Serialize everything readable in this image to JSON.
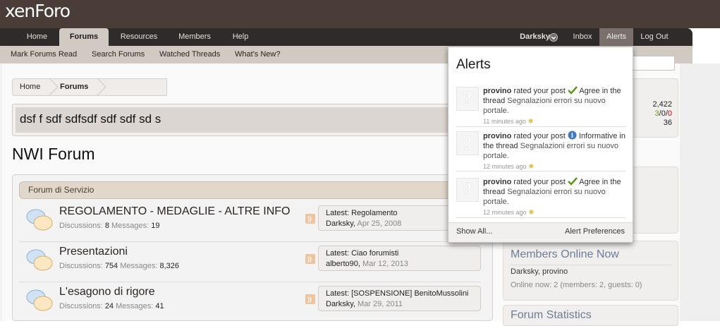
{
  "header": {
    "logo": "xenForo"
  },
  "nav": {
    "tabs": [
      "Home",
      "Forums",
      "Resources",
      "Members",
      "Help"
    ],
    "user": "Darksky",
    "right_links": [
      "Inbox",
      "Alerts",
      "Log Out"
    ]
  },
  "subnav": [
    "Mark Forums Read",
    "Search Forums",
    "Watched Threads",
    "What's New?"
  ],
  "breadcrumb": [
    "Home",
    "Forums"
  ],
  "notice": "dsf f sdf sdfsdf sdf sdf sd s",
  "page_title": "NWI Forum",
  "category": "Forum di Servizio",
  "forums": [
    {
      "title": "REGOLAMENTO - MEDAGLIE - ALTRE INFO",
      "disc_label": "Discussions:",
      "disc": "8",
      "msg_label": "Messages:",
      "msgs": "19",
      "latest_label": "Latest:",
      "latest_title": "Regolamento",
      "latest_user": "Darksky,",
      "latest_date": "Apr 25, 2008"
    },
    {
      "title": "Presentazioni",
      "disc_label": "Discussions:",
      "disc": "754",
      "msg_label": "Messages:",
      "msgs": "8,326",
      "latest_label": "Latest:",
      "latest_title": "Ciao forumisti",
      "latest_user": "alberto90,",
      "latest_date": "Mar 12, 2013"
    },
    {
      "title": "L'esagono di rigore",
      "disc_label": "Discussions:",
      "disc": "24",
      "msg_label": "Messages:",
      "msgs": "41",
      "latest_label": "Latest:",
      "latest_title": "[SOSPENSIONE] BenitoMussolini",
      "latest_user": "Darksky,",
      "latest_date": "Mar 29, 2011"
    }
  ],
  "sidebar": {
    "stats": {
      "v1": "2,422",
      "v2a": "3",
      "v2b": "0",
      "v2c": "0",
      "v3": "36"
    },
    "members_online": {
      "title": "Members Online Now",
      "users": "Darksky, provino",
      "summary": "Online now: 2 (members: 2, guests: 0)"
    },
    "forum_stats_title": "Forum Statistics"
  },
  "alerts": {
    "title": "Alerts",
    "items": [
      {
        "user": "provino",
        "text1": "rated your post",
        "rating": "Agree",
        "text2": "in the",
        "text3": "thread",
        "thread": "Segnalazioni errori su nuovo portale.",
        "time": "11 minutes ago"
      },
      {
        "user": "provino",
        "text1": "rated your post",
        "rating": "Informative",
        "text2": "in the",
        "text3": "thread",
        "thread": "Segnalazioni errori su nuovo portale.",
        "time": "12 minutes ago"
      },
      {
        "user": "provino",
        "text1": "rated your post",
        "rating": "Agree",
        "text2": "in the",
        "text3": "thread",
        "thread": "Segnalazioni errori su nuovo portale.",
        "time": "12 minutes ago"
      }
    ],
    "show_all": "Show All...",
    "preferences": "Alert Preferences"
  }
}
